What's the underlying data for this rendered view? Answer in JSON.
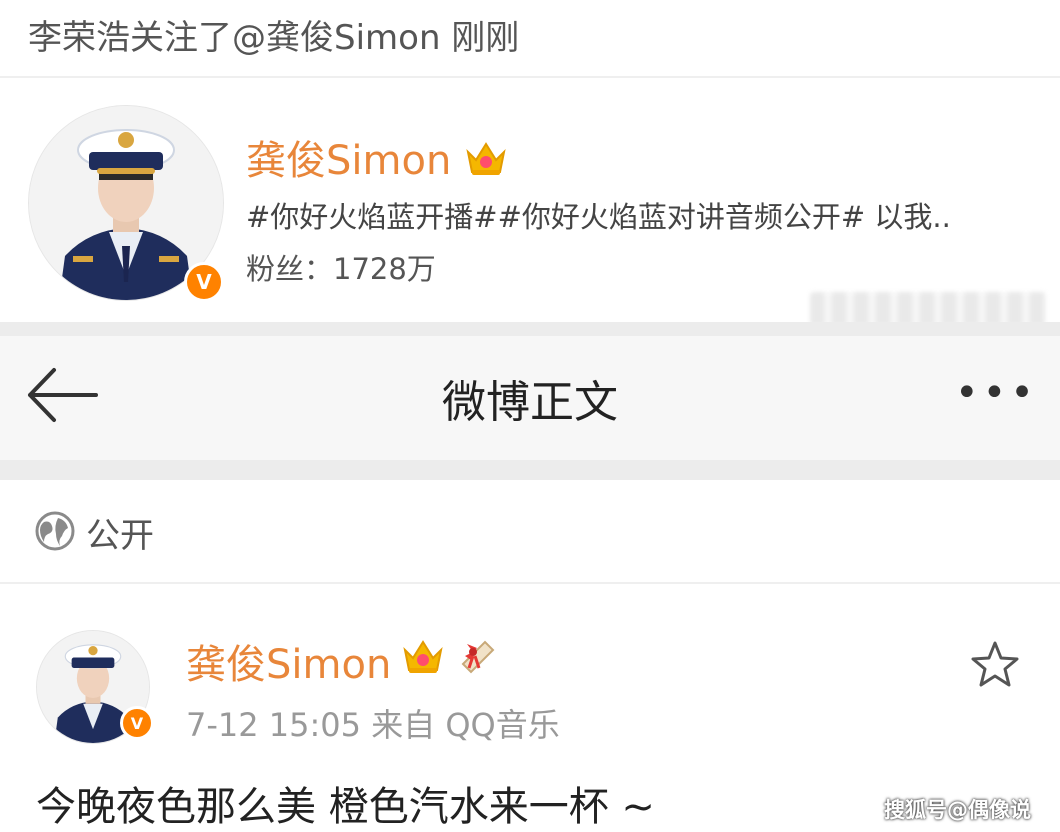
{
  "notice": "李荣浩关注了@龚俊Simon 刚刚",
  "profile_card": {
    "name": "龚俊Simon",
    "topics": "#你好火焰蓝开播##你好火焰蓝对讲音频公开# 以我..",
    "fans": "粉丝：1728万",
    "verified_badge": "V"
  },
  "nav": {
    "back_icon": "back-arrow-icon",
    "title": "微博正文",
    "more_icon": "more-dots-icon",
    "more_text": "•••"
  },
  "visibility": {
    "icon": "globe-icon",
    "label": "公开"
  },
  "post": {
    "author": "龚俊Simon",
    "verified_badge": "V",
    "time_source": "7-12 15:05  来自 QQ音乐",
    "text": "今晚夜色那么美 橙色汽水来一杯 ~",
    "favorite_icon": "star-icon"
  },
  "watermark": "搜狐号@偶像说",
  "colors": {
    "username": "#e8863a",
    "verified": "#ff8200",
    "nav_bg": "#f7f7f7",
    "separator": "#ececec"
  }
}
